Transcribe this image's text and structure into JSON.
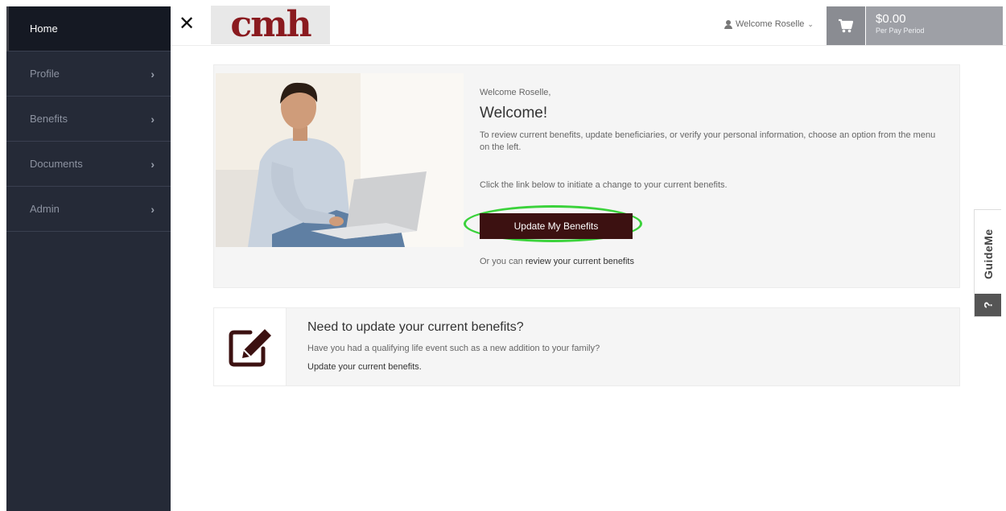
{
  "sidebar": {
    "items": [
      {
        "label": "Home",
        "active": true
      },
      {
        "label": "Profile",
        "chevron": "›"
      },
      {
        "label": "Benefits",
        "chevron": "›"
      },
      {
        "label": "Documents",
        "chevron": "›"
      },
      {
        "label": "Admin",
        "chevron": "›"
      }
    ]
  },
  "header": {
    "close_glyph": "✕",
    "logo_text": "cmh",
    "welcome_user": "Welcome Roselle",
    "cart": {
      "amount": "$0.00",
      "period": "Per Pay Period"
    }
  },
  "welcome_panel": {
    "greeting": "Welcome Roselle,",
    "headline": "Welcome!",
    "description": "To review current benefits, update beneficiaries, or verify your personal information, choose an option from the menu on the left.",
    "instruction": "Click the link below to initiate a change to your current benefits.",
    "button_label": "Update My Benefits",
    "alt_prefix": "Or you can",
    "alt_link": "review your current benefits"
  },
  "update_card": {
    "title": "Need to update your current benefits?",
    "subtitle": "Have you had a qualifying life event such as a new addition to your family?",
    "link": "Update your current benefits."
  },
  "guide": {
    "label": "GuideMe",
    "help_glyph": "?"
  },
  "colors": {
    "sidebar": "#252a37",
    "button": "#3c1111",
    "highlight": "#3bd23b",
    "logo": "#8a1a1f"
  }
}
